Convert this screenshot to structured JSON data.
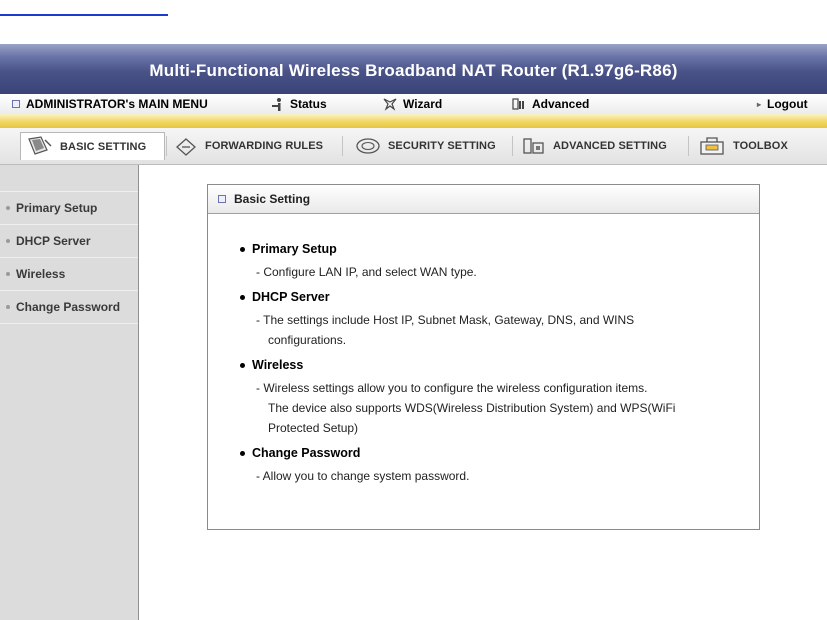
{
  "header": {
    "title": "Multi-Functional Wireless Broadband NAT Router (R1.97g6-R86)"
  },
  "menu": {
    "main_label": "ADMINISTRATOR's MAIN MENU",
    "status_label": "Status",
    "wizard_label": "Wizard",
    "advanced_label": "Advanced",
    "logout_label": "Logout"
  },
  "tabs": [
    {
      "label": "BASIC SETTING",
      "icon": "basic-setting-icon",
      "active": true
    },
    {
      "label": "FORWARDING RULES",
      "icon": "forwarding-rules-icon"
    },
    {
      "label": "SECURITY SETTING",
      "icon": "security-setting-icon"
    },
    {
      "label": "ADVANCED SETTING",
      "icon": "advanced-setting-icon"
    },
    {
      "label": "TOOLBOX",
      "icon": "toolbox-icon"
    }
  ],
  "sidebar": {
    "items": [
      {
        "label": "Primary Setup"
      },
      {
        "label": "DHCP Server"
      },
      {
        "label": "Wireless"
      },
      {
        "label": "Change Password"
      }
    ]
  },
  "panel": {
    "title": "Basic Setting",
    "sections": [
      {
        "title": "Primary Setup",
        "lines": [
          "- Configure LAN IP, and select WAN type."
        ]
      },
      {
        "title": "DHCP Server",
        "lines": [
          "- The settings include Host IP, Subnet Mask, Gateway, DNS, and WINS",
          "configurations."
        ]
      },
      {
        "title": "Wireless",
        "lines": [
          "- Wireless settings allow you to configure the wireless configuration items.",
          "The device also supports WDS(Wireless Distribution System) and WPS(WiFi",
          "Protected Setup)"
        ]
      },
      {
        "title": "Change Password",
        "lines": [
          "- Allow you to change system password."
        ]
      }
    ]
  },
  "colors": {
    "title_bar": "#4a5388",
    "gold_band": "#f4dc72",
    "sidebar_bg": "#dcdcdc"
  }
}
